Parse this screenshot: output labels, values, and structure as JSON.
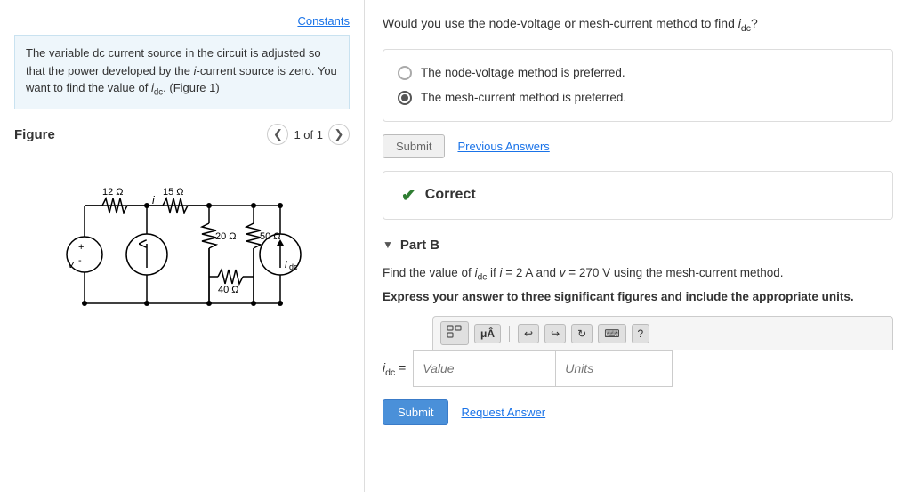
{
  "left": {
    "constants_link": "Constants",
    "problem_text": "The variable dc current source in the circuit is adjusted so that the power developed by the i-current source is zero. You want to find the value of i̲dc. (Figure 1)",
    "figure_title": "Figure",
    "page_count": "1 of 1"
  },
  "right": {
    "question": "Would you use the node-voltage or mesh-current method to find i̲dc?",
    "option1": "The node-voltage method is preferred.",
    "option2": "The mesh-current method is preferred.",
    "submit_label": "Submit",
    "prev_answers_label": "Previous Answers",
    "correct_label": "Correct",
    "part_b_label": "Part B",
    "part_b_text": "Find the value of i̲dc if i = 2 A and v = 270 V using the mesh-current method.",
    "part_b_bold": "Express your answer to three significant figures and include the appropriate units.",
    "idc_label": "i̲dc =",
    "value_placeholder": "Value",
    "units_placeholder": "Units",
    "submit_b_label": "Submit",
    "request_answer_label": "Request Answer",
    "toolbar": {
      "fraction_icon": "⊞",
      "mu_icon": "μÂ",
      "undo_icon": "↩",
      "redo_icon": "↪",
      "refresh_icon": "↻",
      "keyboard_icon": "⌨",
      "help_icon": "?"
    }
  }
}
